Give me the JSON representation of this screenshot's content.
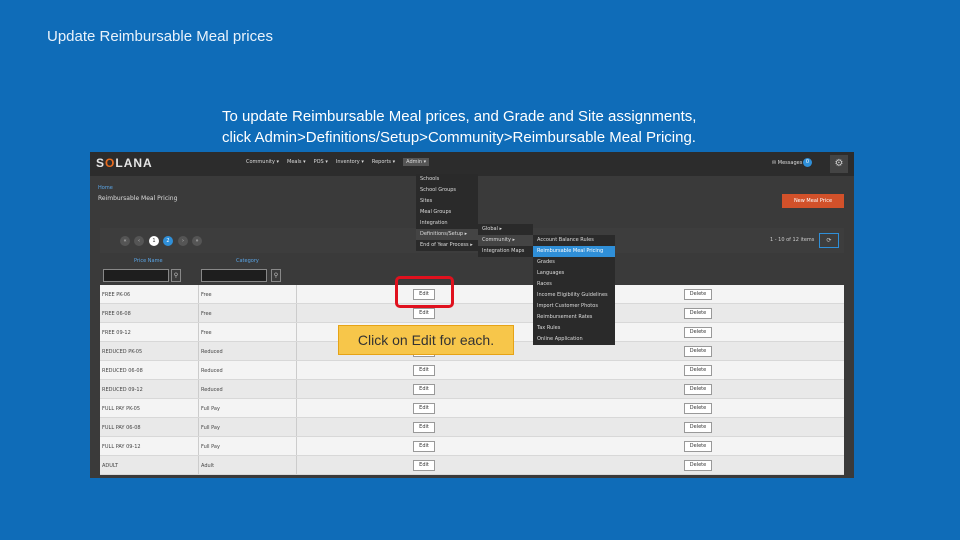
{
  "slide": {
    "title": "Update Reimbursable Meal prices",
    "caption_line1": "To update Reimbursable Meal prices, and Grade and Site assignments,",
    "caption_line2": "click Admin>Definitions/Setup>Community>Reimbursable Meal Pricing.",
    "callout": "Click on Edit for each."
  },
  "app": {
    "logo_pre": "S",
    "logo_o": "O",
    "logo_post": "LANA",
    "nav": [
      "Community ▾",
      "Meals ▾",
      "POS ▾",
      "Inventory ▾",
      "Reports ▾",
      "Admin ▾"
    ],
    "messages_label": "Messages",
    "messages_count": "0",
    "breadcrumb": "Home",
    "page_title": "Reimbursable Meal Pricing",
    "new_button": "New Meal Price",
    "pager": [
      "«",
      "‹",
      "1",
      "2",
      "›",
      "»"
    ],
    "items_text": "1 - 10 of 12 items",
    "col_price_name": "Price Name",
    "col_category": "Category",
    "edit_label": "Edit",
    "delete_label": "Delete",
    "rows": [
      {
        "name": "FREE PK-06",
        "category": "Free"
      },
      {
        "name": "FREE 06-08",
        "category": "Free"
      },
      {
        "name": "FREE 09-12",
        "category": "Free"
      },
      {
        "name": "REDUCED PK-05",
        "category": "Reduced"
      },
      {
        "name": "REDUCED 06-08",
        "category": "Reduced"
      },
      {
        "name": "REDUCED 09-12",
        "category": "Reduced"
      },
      {
        "name": "FULL PAY PK-05",
        "category": "Full Pay"
      },
      {
        "name": "FULL PAY 06-08",
        "category": "Full Pay"
      },
      {
        "name": "FULL PAY 09-12",
        "category": "Full Pay"
      },
      {
        "name": "ADULT",
        "category": "Adult"
      }
    ],
    "admin_menu": [
      "Schools",
      "School Groups",
      "Sites",
      "Meal Groups",
      "Integration",
      "Definitions/Setup ▸",
      "End of Year Process ▸"
    ],
    "setup_menu": [
      "Global ▸",
      "Community ▸",
      "Integration Maps"
    ],
    "community_menu": [
      "Account Balance Rules",
      "Reimbursable Meal Pricing",
      "Grades",
      "Languages",
      "Races",
      "Income Eligibility Guidelines",
      "Import Customer Photos",
      "Reimbursement Rates",
      "Tax Rules",
      "Online Application"
    ]
  },
  "colors": {
    "background": "#0f6cb8",
    "accent": "#2f8fd8",
    "highlight": "#e0111e",
    "callout": "#f7c64a",
    "new_button": "#d2512a"
  }
}
